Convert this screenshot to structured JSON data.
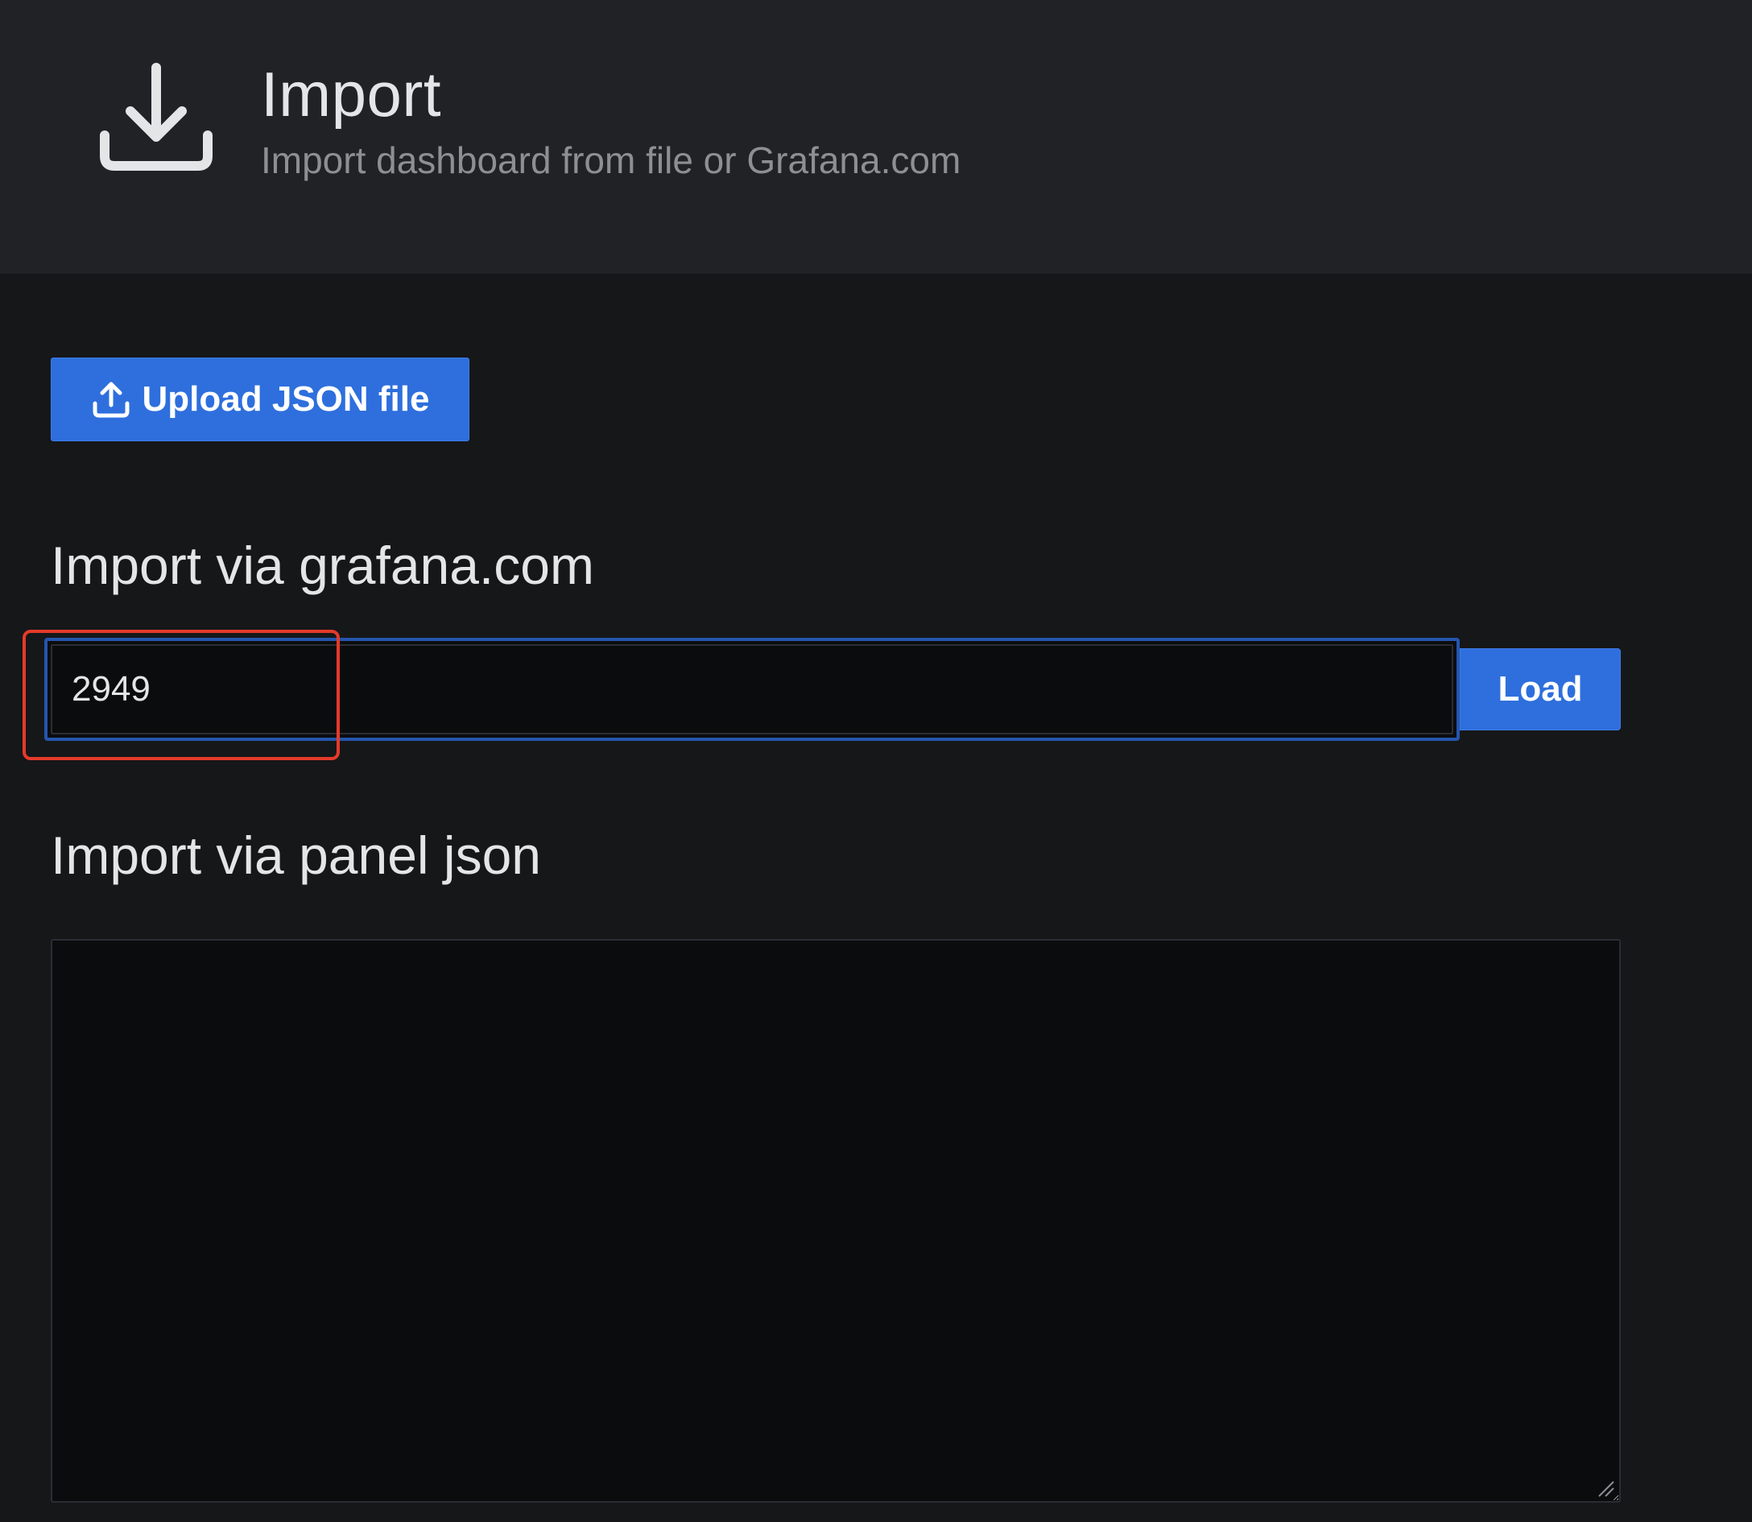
{
  "header": {
    "icon": "download-icon",
    "title": "Import",
    "subtitle": "Import dashboard from file or Grafana.com"
  },
  "upload": {
    "icon": "upload-icon",
    "label": "Upload JSON file"
  },
  "grafana_com": {
    "heading": "Import via grafana.com",
    "input_value": "2949",
    "load_label": "Load"
  },
  "panel_json": {
    "heading": "Import via panel json",
    "value": ""
  },
  "colors": {
    "primary_button": "#2e6fdd",
    "highlight": "#e53a2a",
    "background": "#161719",
    "header_background": "#212226"
  }
}
